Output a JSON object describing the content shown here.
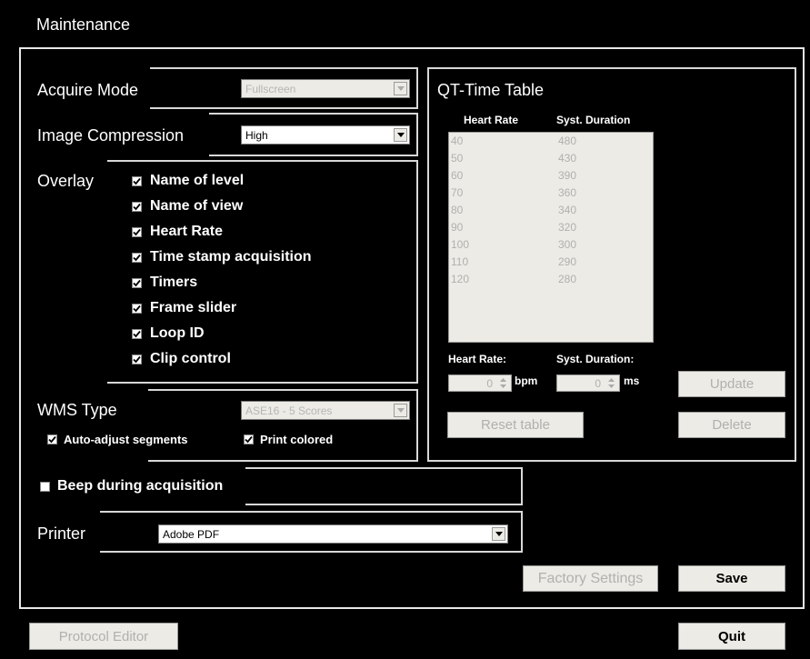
{
  "window": {
    "title": "Maintenance"
  },
  "acquire": {
    "label": "Acquire Mode",
    "value": "Fullscreen"
  },
  "compression": {
    "label": "Image Compression",
    "value": "High"
  },
  "overlay": {
    "label": "Overlay",
    "items": [
      {
        "label": "Name of level",
        "checked": true
      },
      {
        "label": "Name of view",
        "checked": true
      },
      {
        "label": "Heart Rate",
        "checked": true
      },
      {
        "label": "Time stamp acquisition",
        "checked": true
      },
      {
        "label": "Timers",
        "checked": true
      },
      {
        "label": "Frame slider",
        "checked": true
      },
      {
        "label": "Loop ID",
        "checked": true
      },
      {
        "label": "Clip control",
        "checked": true
      }
    ]
  },
  "wms": {
    "label": "WMS Type",
    "value": "ASE16 - 5 Scores",
    "auto_adjust": "Auto-adjust segments",
    "print_colored": "Print colored"
  },
  "qt": {
    "title": "QT-Time Table",
    "col_hr": "Heart Rate",
    "col_syst": "Syst. Duration",
    "rows": [
      {
        "hr": "40",
        "syst": "480"
      },
      {
        "hr": "50",
        "syst": "430"
      },
      {
        "hr": "60",
        "syst": "390"
      },
      {
        "hr": "70",
        "syst": "360"
      },
      {
        "hr": "80",
        "syst": "340"
      },
      {
        "hr": "90",
        "syst": "320"
      },
      {
        "hr": "100",
        "syst": "300"
      },
      {
        "hr": "110",
        "syst": "290"
      },
      {
        "hr": "120",
        "syst": "280"
      }
    ],
    "hr_label": "Heart Rate:",
    "syst_label": "Syst. Duration:",
    "hr_value": "0",
    "syst_value": "0",
    "hr_unit": "bpm",
    "syst_unit": "ms",
    "update": "Update",
    "reset": "Reset table",
    "delete": "Delete"
  },
  "beep": {
    "label": "Beep during acquisition",
    "checked": false
  },
  "printer": {
    "label": "Printer",
    "value": "Adobe PDF"
  },
  "buttons": {
    "factory": "Factory Settings",
    "save": "Save",
    "protocol": "Protocol Editor",
    "quit": "Quit"
  },
  "icons": {
    "checkbox": "checkmark-icon",
    "dropdown": "chevron-down-icon",
    "spinner": "spinner-arrows-icon"
  }
}
